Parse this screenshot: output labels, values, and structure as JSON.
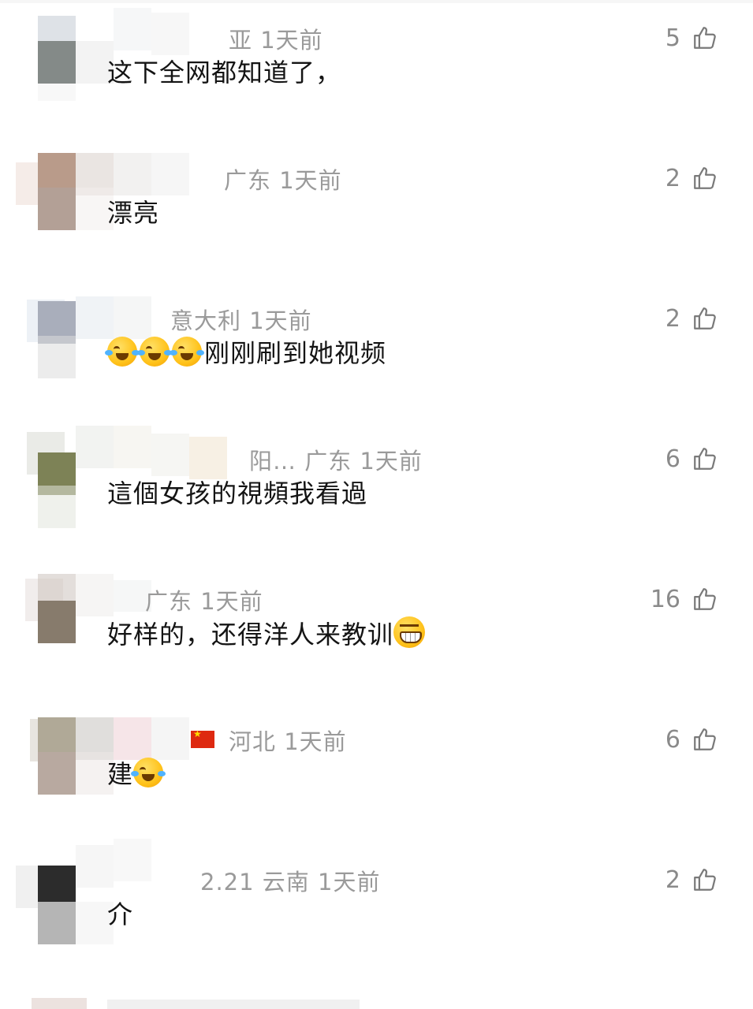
{
  "comments": [
    {
      "meta": "亚 1天前",
      "text_before": "这下全网都知道了，",
      "text_after": "",
      "likes": "5"
    },
    {
      "meta": "广东 1天前",
      "text_before": "漂亮",
      "text_after": "",
      "likes": "2"
    },
    {
      "meta": "意大利 1天前",
      "text_before": "",
      "text_after": "刚刚刷到她视频",
      "likes": "2"
    },
    {
      "meta": "阳… 广东 1天前",
      "text_before": "這個女孩的視頻我看過",
      "text_after": "",
      "likes": "6"
    },
    {
      "meta": "广东 1天前",
      "text_before": "好样的，还得洋人来教训",
      "text_after": "",
      "likes": "16"
    },
    {
      "meta": "河北 1天前",
      "text_before": "建",
      "text_after": "",
      "likes": "6"
    },
    {
      "meta": "2.21 云南 1天前",
      "text_before": "介",
      "text_after": "",
      "likes": "2"
    }
  ],
  "icons": {
    "like": "thumbs-up-icon",
    "flag": "china-flag-icon",
    "emoji_cry": "laughing-crying-emoji",
    "emoji_grin": "grinning-emoji"
  },
  "colors": {
    "meta": "#9a9a9a",
    "text": "#141414",
    "likes": "#8a8a8a"
  }
}
